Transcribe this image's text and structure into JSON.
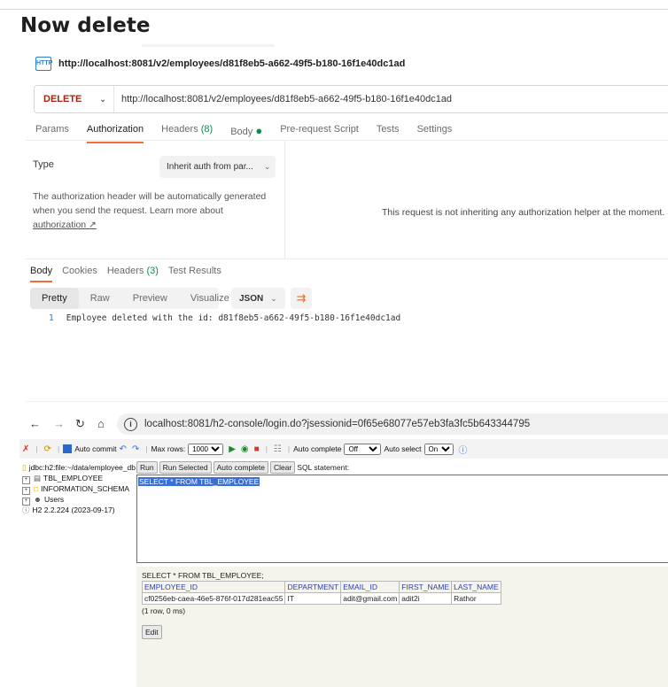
{
  "page": {
    "heading": "Now delete"
  },
  "postman": {
    "request_title": "http://localhost:8081/v2/employees/d81f8eb5-a662-49f5-b180-16f1e40dc1ad",
    "http_icon": "HTTP",
    "method": "DELETE",
    "url": "http://localhost:8081/v2/employees/d81f8eb5-a662-49f5-b180-16f1e40dc1ad",
    "tabs": [
      {
        "label": "Params"
      },
      {
        "label": "Authorization"
      },
      {
        "label": "Headers",
        "count": "(8)"
      },
      {
        "label": "Body",
        "dot": "●"
      },
      {
        "label": "Pre-request Script"
      },
      {
        "label": "Tests"
      },
      {
        "label": "Settings"
      }
    ],
    "active_tab": "Authorization",
    "auth": {
      "type_label": "Type",
      "type_value": "Inherit auth from par...",
      "description": "The authorization header will be automatically generated when you send the request. Learn more about",
      "link_label": "authorization ↗",
      "right_message": "This request is not inheriting any authorization helper at the moment. S"
    },
    "response_tabs": [
      {
        "label": "Body"
      },
      {
        "label": "Cookies"
      },
      {
        "label": "Headers",
        "count": "(3)"
      },
      {
        "label": "Test Results"
      }
    ],
    "format_options": [
      "Pretty",
      "Raw",
      "Preview",
      "Visualize"
    ],
    "active_format": "Pretty",
    "format_type": "JSON",
    "response_line_number": "1",
    "response_body": "Employee deleted with the id: d81f8eb5-a662-49f5-b180-16f1e40dc1ad"
  },
  "browser": {
    "url": "localhost:8081/h2-console/login.do?jsessionid=0f65e68077e57eb3fa3fc5b643344795"
  },
  "h2": {
    "toolbar": {
      "auto_commit_label": "Auto commit",
      "max_rows_label": "Max rows:",
      "max_rows_value": "1000",
      "auto_complete_label": "Auto complete",
      "auto_complete_value": "Off",
      "auto_select_label": "Auto select",
      "auto_select_value": "On"
    },
    "tree": {
      "connection": "jdbc:h2:file:~/data/employee_db",
      "items": [
        "TBL_EMPLOYEE",
        "INFORMATION_SCHEMA",
        "Users"
      ],
      "version": "H2 2.2.224 (2023-09-17)"
    },
    "buttons": {
      "run": "Run",
      "run_selected": "Run Selected",
      "auto_complete": "Auto complete",
      "clear": "Clear",
      "sql_statement_label": "SQL statement:"
    },
    "sql_text": "SELECT * FROM TBL_EMPLOYEE",
    "result": {
      "query": "SELECT * FROM TBL_EMPLOYEE;",
      "columns": [
        "EMPLOYEE_ID",
        "DEPARTMENT",
        "EMAIL_ID",
        "FIRST_NAME",
        "LAST_NAME"
      ],
      "rows": [
        [
          "cf0256eb-caea-46e5-876f-017d281eac55",
          "IT",
          "adit@gmail.com",
          "adit2i",
          "Rathor"
        ]
      ],
      "meta": "(1 row, 0 ms)",
      "edit_label": "Edit"
    }
  }
}
